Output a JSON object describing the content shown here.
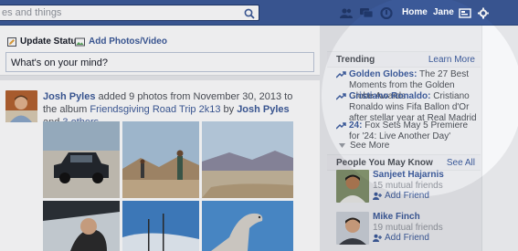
{
  "search": {
    "value": "es and things"
  },
  "topnav": {
    "home": "Home",
    "profile": "Jane"
  },
  "composer": {
    "update_status": "Update Status",
    "add_photos": "Add Photos/Video",
    "placeholder": "What's on your mind?"
  },
  "story": {
    "author": "Josh Pyles",
    "text_1": " added 9 photos from November 30, 2013 to the album ",
    "album": "Friendsgiving Road Trip 2k13",
    "text_2": " by ",
    "by_name": "Josh Pyles",
    "text_3": " and ",
    "others": "3 others",
    "text_4": "."
  },
  "trending": {
    "title": "Trending",
    "action": "Learn More",
    "items": [
      {
        "name": "Golden Globes:",
        "text": " The 27 Best Moments from the Golden Globe Awards"
      },
      {
        "name": "Cristiano Ronaldo:",
        "text": " Cristiano Ronaldo wins Fifa Ballon d'Or after stellar year at Real Madrid"
      },
      {
        "name": "24:",
        "text": " Fox Sets May 5 Premiere for '24: Live Another Day'"
      }
    ],
    "see_more": "See More"
  },
  "people": {
    "title": "People You May Know",
    "action": "See All",
    "items": [
      {
        "name": "Sanjeet Hajarnis",
        "mutual": "15 mutual friends",
        "add": "Add Friend"
      },
      {
        "name": "Mike Finch",
        "mutual": "19 mutual friends",
        "add": "Add Friend"
      }
    ]
  },
  "colors": {
    "brand": "#3b5998",
    "background": "#e9eaed"
  }
}
